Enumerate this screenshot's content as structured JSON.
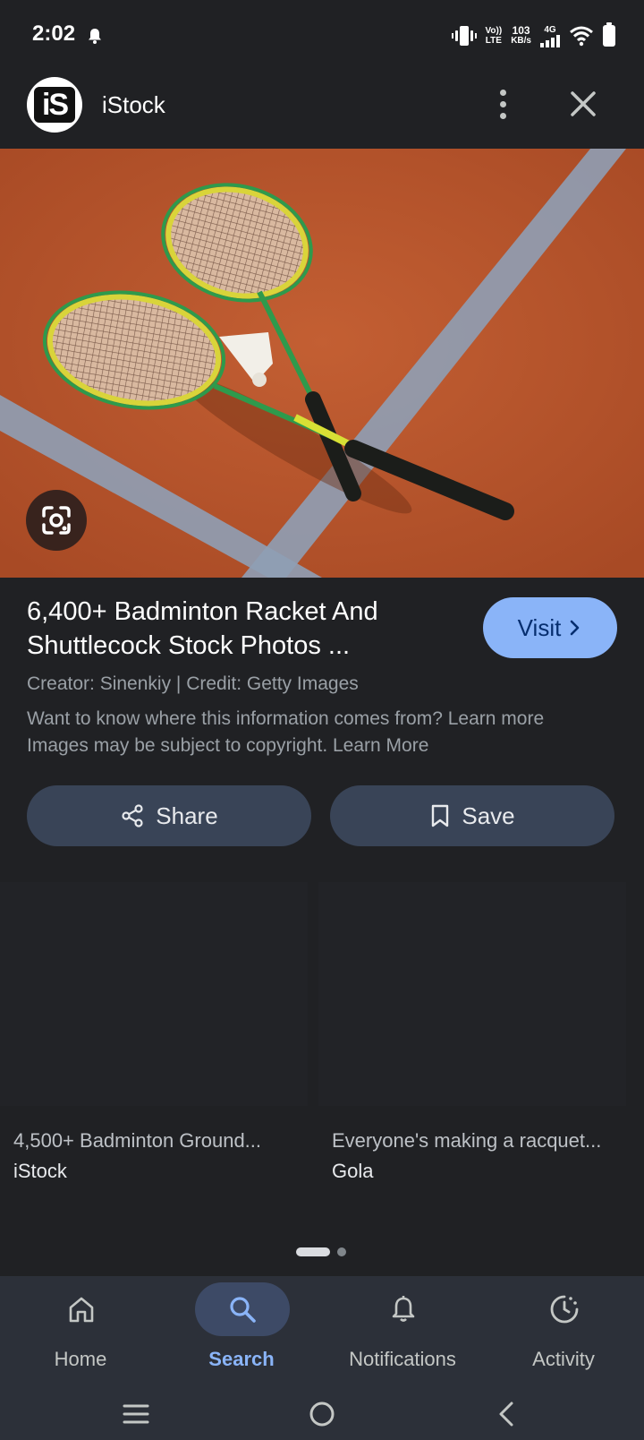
{
  "status_bar": {
    "time": "2:02",
    "volte_line1": "Vo))",
    "volte_line2": "LTE",
    "speed_value": "103",
    "speed_unit": "KB/s",
    "network_type": "4G"
  },
  "header": {
    "logo_text": "iS",
    "title": "iStock"
  },
  "result": {
    "title": "6,400+ Badminton Racket And Shuttlecock Stock Photos ...",
    "visit_label": "Visit",
    "credit": "Creator: Sinenkiy | Credit: Getty Images",
    "info_line": "Want to know where this information comes from? Learn more",
    "copyright_line": "Images may be subject to copyright. Learn More"
  },
  "actions": {
    "share_label": "Share",
    "save_label": "Save"
  },
  "related": [
    {
      "title": "4,500+ Badminton Ground...",
      "source": "iStock"
    },
    {
      "title": "Everyone's making a racquet...",
      "source": "Gola"
    }
  ],
  "bottom_nav": {
    "items": [
      {
        "label": "Home",
        "icon": "home-icon",
        "active": false
      },
      {
        "label": "Search",
        "icon": "search-icon",
        "active": true
      },
      {
        "label": "Notifications",
        "icon": "bell-icon",
        "active": false
      },
      {
        "label": "Activity",
        "icon": "activity-icon",
        "active": false
      }
    ]
  },
  "colors": {
    "background": "#202124",
    "accent": "#8ab4f8",
    "button_surface": "#394457",
    "nav_surface": "#2c3039"
  }
}
